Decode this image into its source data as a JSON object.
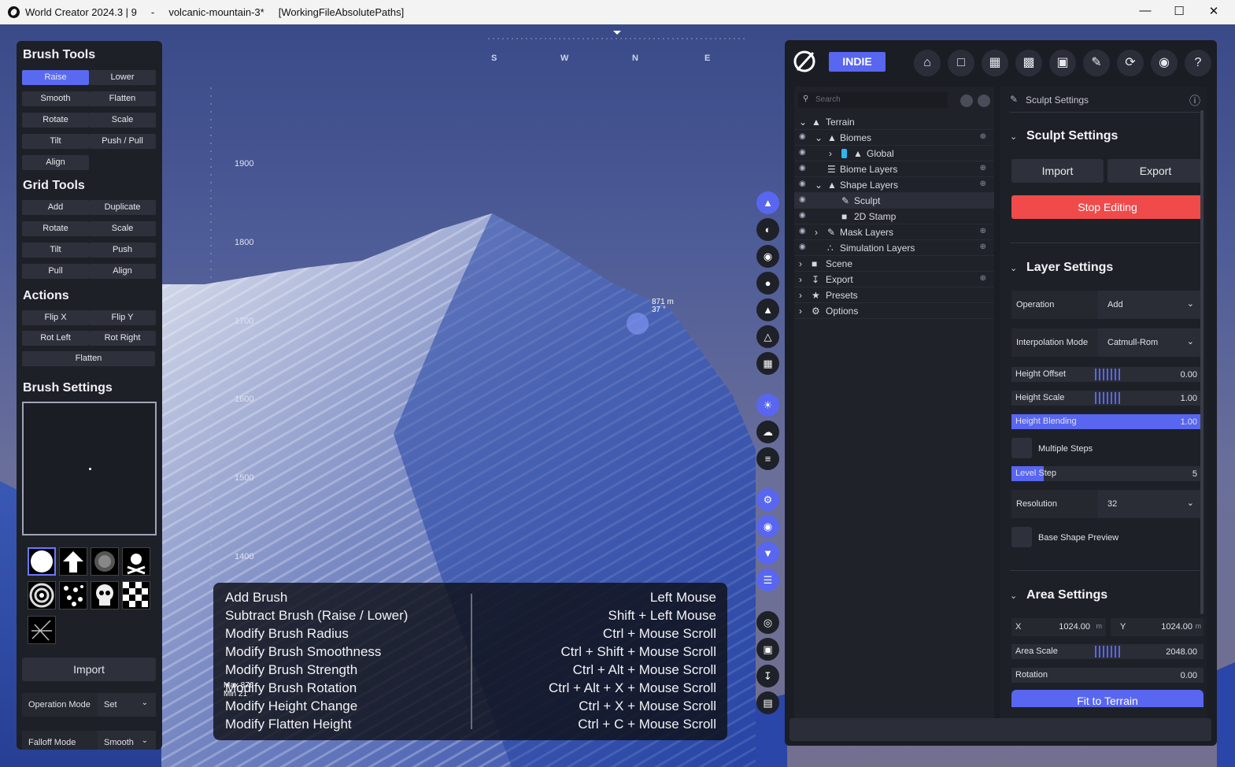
{
  "window": {
    "title": "World Creator 2024.3 | 9     -     volcanic-mountain-3*     [WorkingFileAbsolutePaths]",
    "minimize": "—",
    "maximize": "☐",
    "close": "✕"
  },
  "viewport": {
    "compass": [
      "S",
      "W",
      "N",
      "E"
    ],
    "altitudes": [
      "1900",
      "1800",
      "1700",
      "1600",
      "1500",
      "1400"
    ],
    "marker_height": "871 m",
    "marker_angle": "37 °",
    "brush_max": "Max 876",
    "brush_min": "Min 21"
  },
  "left_panel": {
    "brush_tools_title": "Brush Tools",
    "brush_tools": [
      "Raise",
      "Lower",
      "Smooth",
      "Flatten",
      "Rotate",
      "Scale",
      "Tilt",
      "Push / Pull",
      "Align"
    ],
    "grid_tools_title": "Grid Tools",
    "grid_tools": [
      "Add",
      "Duplicate",
      "Rotate",
      "Scale",
      "Tilt",
      "Push",
      "Pull",
      "Align"
    ],
    "actions_title": "Actions",
    "actions": [
      "Flip X",
      "Flip Y",
      "Rot Left",
      "Rot Right",
      "Flatten"
    ],
    "brush_settings_title": "Brush Settings",
    "import_label": "Import",
    "operation_mode_label": "Operation Mode",
    "operation_mode_value": "Set",
    "falloff_mode_label": "Falloff Mode",
    "falloff_mode_value": "Smooth"
  },
  "shortcuts": {
    "actions": [
      "Add Brush",
      "Subtract Brush (Raise / Lower)",
      "Modify Brush Radius",
      "Modify Brush Smoothness",
      "Modify Brush Strength",
      "Modify Brush Rotation",
      "Modify Height Change",
      "Modify Flatten Height"
    ],
    "keys": [
      "Left Mouse",
      "Shift + Left Mouse",
      "Ctrl + Mouse Scroll",
      "Ctrl + Shift + Mouse Scroll",
      "Ctrl + Alt + Mouse Scroll",
      "Ctrl + Alt + X + Mouse Scroll",
      "Ctrl + X + Mouse Scroll",
      "Ctrl + C + Mouse Scroll"
    ]
  },
  "right_panel": {
    "edition": "INDIE",
    "search_placeholder": "Search",
    "tree": {
      "terrain": "Terrain",
      "biomes": "Biomes",
      "global": "Global",
      "biome_layers": "Biome Layers",
      "shape_layers": "Shape Layers",
      "sculpt": "Sculpt",
      "stamp": "2D Stamp",
      "mask_layers": "Mask Layers",
      "simulation_layers": "Simulation Layers",
      "scene": "Scene",
      "export": "Export",
      "presets": "Presets",
      "options": "Options"
    },
    "panel_header": "Sculpt Settings",
    "sculpt_settings_title": "Sculpt Settings",
    "import_label": "Import",
    "export_label": "Export",
    "stop_editing_label": "Stop Editing",
    "layer_settings_title": "Layer Settings",
    "operation_label": "Operation",
    "operation_value": "Add",
    "interpolation_label": "Interpolation Mode",
    "interpolation_value": "Catmull-Rom",
    "height_offset_label": "Height Offset",
    "height_offset_value": "0.00",
    "height_scale_label": "Height Scale",
    "height_scale_value": "1.00",
    "height_blending_label": "Height Blending",
    "height_blending_value": "1.00",
    "multiple_steps_label": "Multiple Steps",
    "level_step_label": "Level Step",
    "level_step_value": "5",
    "resolution_label": "Resolution",
    "resolution_value": "32",
    "base_shape_label": "Base Shape Preview",
    "area_settings_title": "Area Settings",
    "x_label": "X",
    "x_value": "1024.00",
    "y_label": "Y",
    "y_value": "1024.00",
    "unit": "m",
    "area_scale_label": "Area Scale",
    "area_scale_value": "2048.00",
    "rotation_label": "Rotation",
    "rotation_value": "0.00",
    "fit_label": "Fit to Terrain"
  },
  "colors": {
    "accent": "#5866f0",
    "danger": "#f04a4a",
    "panel": "#1e2027"
  }
}
